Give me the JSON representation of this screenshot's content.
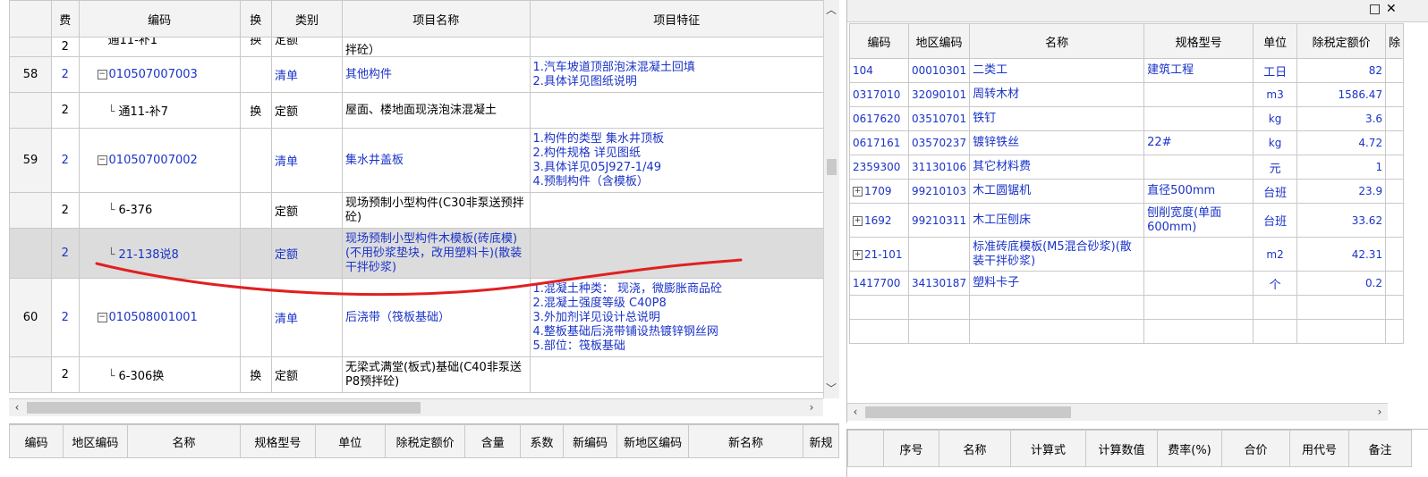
{
  "left_grid": {
    "headers": [
      "费",
      "编码",
      "换",
      "类别",
      "项目名称",
      "项目特征"
    ],
    "top_partial": {
      "fee": "2",
      "code": "通11-补1",
      "swap": "换",
      "type": "定额",
      "name": "拌砼）"
    },
    "rows": [
      {
        "num": "58",
        "fee": "2",
        "code": "010507007003",
        "swap": "",
        "type": "清单",
        "name": "其他构件",
        "features": [
          "1.汽车坡道顶部泡沫混凝土回填",
          "2.具体详见图纸说明"
        ],
        "level": 1,
        "blue": true
      },
      {
        "num": "",
        "fee": "2",
        "code": "通11-补7",
        "swap": "换",
        "type": "定额",
        "name": "屋面、楼地面现浇泡沫混凝土",
        "features": [],
        "level": 2,
        "blue": false
      },
      {
        "num": "59",
        "fee": "2",
        "code": "010507007002",
        "swap": "",
        "type": "清单",
        "name": "集水井盖板",
        "features": [
          "1.构件的类型 集水井顶板",
          "2.构件规格 详见图纸",
          "3.具体详见05J927-1/49",
          "4.预制构件（含模板）"
        ],
        "level": 1,
        "blue": true
      },
      {
        "num": "",
        "fee": "2",
        "code": "6-376",
        "swap": "",
        "type": "定额",
        "name": "现场预制小型构件(C30非泵送预拌砼)",
        "features": [],
        "level": 2,
        "blue": false
      },
      {
        "num": "",
        "fee": "2",
        "code": "21-138说8",
        "swap": "",
        "type": "定额",
        "name": "现场预制小型构件木模板(砖底模)(不用砂浆垫块，改用塑料卡)(散装干拌砂浆)",
        "features": [],
        "level": 2,
        "blue": true,
        "selected": true
      },
      {
        "num": "60",
        "fee": "2",
        "code": "010508001001",
        "swap": "",
        "type": "清单",
        "name": "后浇带（筏板基础）",
        "features": [
          "1.混凝土种类： 现浇，微膨胀商品砼",
          "2.混凝土强度等级 C40P8",
          "3.外加剂详见设计总说明",
          "4.整板基础后浇带铺设热镀锌钢丝网",
          "5.部位：筏板基础"
        ],
        "level": 1,
        "blue": true
      },
      {
        "num": "",
        "fee": "2",
        "code": "6-306换",
        "swap": "换",
        "type": "定额",
        "name": "无梁式满堂(板式)基础(C40非泵送P8预拌砼)",
        "features": [],
        "level": 2,
        "blue": false
      }
    ]
  },
  "left_bottom_headers": [
    "编码",
    "地区编码",
    "名称",
    "规格型号",
    "单位",
    "除税定额价",
    "含量",
    "系数",
    "新编码",
    "新地区编码",
    "新名称",
    "新规"
  ],
  "right_grid": {
    "headers": [
      "编码",
      "地区编码",
      "名称",
      "规格型号",
      "单位",
      "除税定额价",
      "除"
    ],
    "rows": [
      {
        "code": "104",
        "area": "00010301",
        "name": "二类工",
        "spec": "建筑工程",
        "unit": "工日",
        "price": "82",
        "expand": false
      },
      {
        "code": "0317010",
        "area": "32090101",
        "name": "周转木材",
        "spec": "",
        "unit": "m3",
        "price": "1586.47",
        "expand": false
      },
      {
        "code": "0617620",
        "area": "03510701",
        "name": "铁钉",
        "spec": "",
        "unit": "kg",
        "price": "3.6",
        "expand": false
      },
      {
        "code": "0617161",
        "area": "03570237",
        "name": "镀锌铁丝",
        "spec": "22#",
        "unit": "kg",
        "price": "4.72",
        "expand": false
      },
      {
        "code": "2359300",
        "area": "31130106",
        "name": "其它材料费",
        "spec": "",
        "unit": "元",
        "price": "1",
        "expand": false
      },
      {
        "code": "1709",
        "area": "99210103",
        "name": "木工圆锯机",
        "spec": "直径500mm",
        "unit": "台班",
        "price": "23.9",
        "expand": true
      },
      {
        "code": "1692",
        "area": "99210311",
        "name": "木工压刨床",
        "spec": "刨削宽度(单面600mm)",
        "unit": "台班",
        "price": "33.62",
        "expand": true
      },
      {
        "code": "21-101",
        "area": "",
        "name": "标准砖底模板(M5混合砂浆)(散装干拌砂浆)",
        "spec": "",
        "unit": "m2",
        "price": "42.31",
        "expand": true
      },
      {
        "code": "1417700",
        "area": "34130187",
        "name": "塑料卡子",
        "spec": "",
        "unit": "个",
        "price": "0.2",
        "expand": false
      }
    ]
  },
  "right_bottom_headers": [
    "序号",
    "名称",
    "计算式",
    "计算数值",
    "费率(%)",
    "合价",
    "用代号",
    "备注"
  ],
  "window_controls": {
    "restore": "□",
    "close": "✕"
  },
  "scroll_arrows": {
    "up": "︿",
    "down": "﹀",
    "left": "‹",
    "right": "›"
  },
  "colors": {
    "link": "#1a33c8",
    "selected_row": "#dcdcdc",
    "annotation": "#e02020"
  }
}
